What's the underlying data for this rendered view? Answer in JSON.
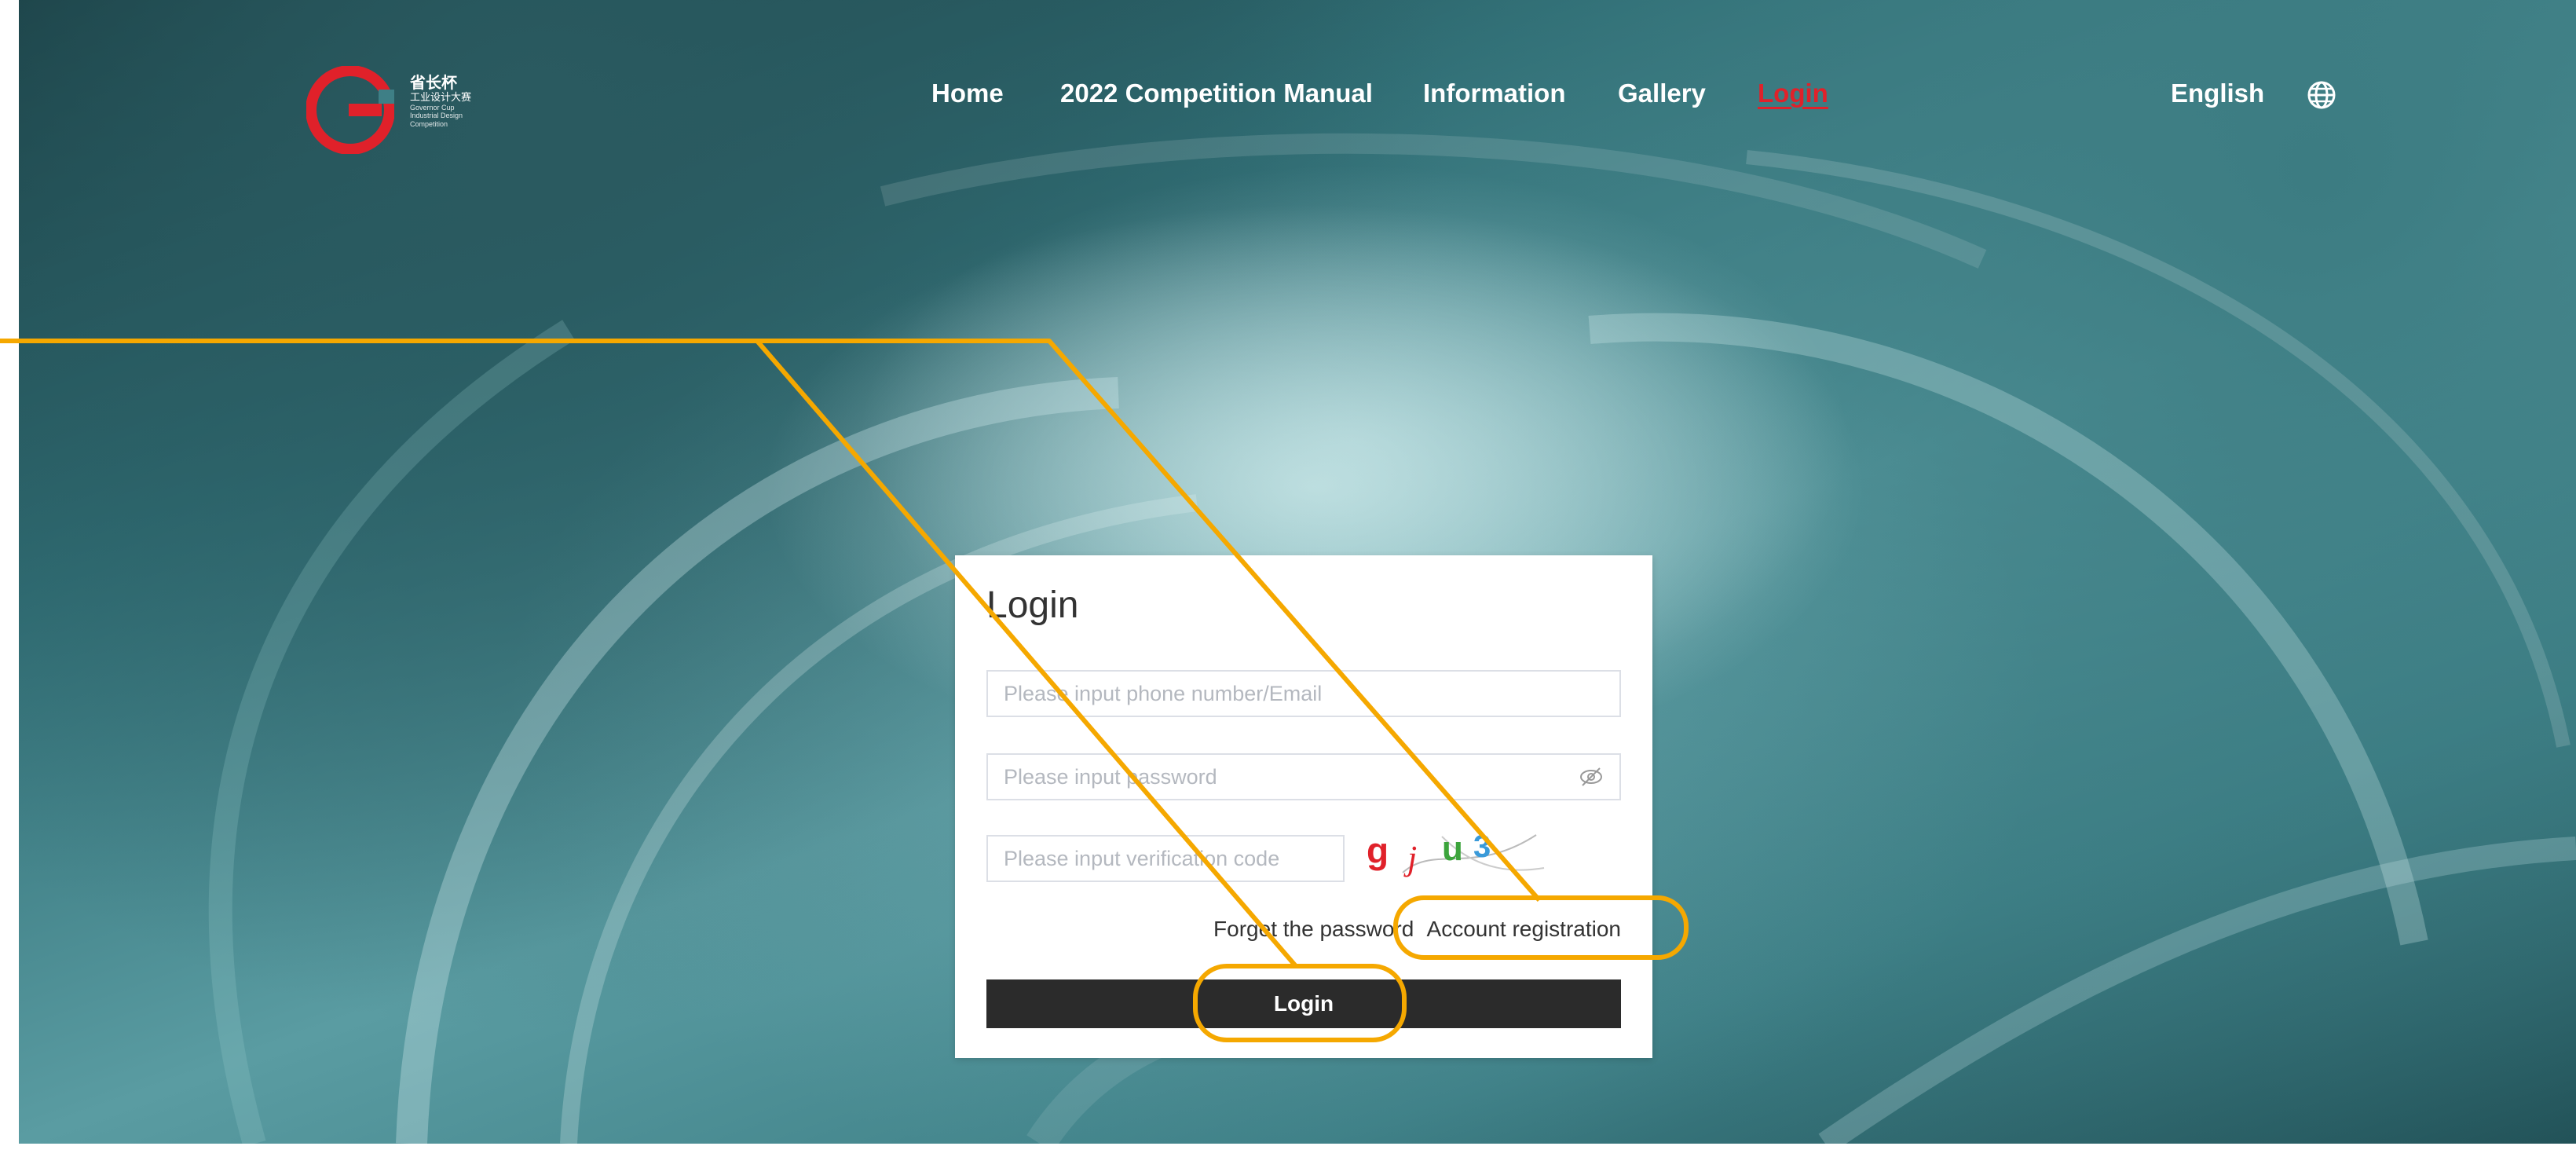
{
  "header": {
    "logo_text": {
      "cn_name": "省长杯",
      "cn_subtitle": "工业设计大赛",
      "en_line1": "Governor Cup",
      "en_line2": "Industrial Design",
      "en_line3": "Competition"
    },
    "nav": [
      {
        "label": "Home"
      },
      {
        "label": "2022 Competition Manual"
      },
      {
        "label": "Information"
      },
      {
        "label": "Gallery"
      },
      {
        "label": "Login",
        "active": true
      }
    ],
    "language_label": "English",
    "language_icon": "globe-icon"
  },
  "login_form": {
    "title": "Login",
    "account": {
      "placeholder": "Please input phone number/Email",
      "value": ""
    },
    "password": {
      "placeholder": "Please input password",
      "value": "",
      "toggle_icon": "eye-slash-icon"
    },
    "verification": {
      "placeholder": "Please input verification code",
      "value": ""
    },
    "captcha_chars": [
      "g",
      "j",
      "u",
      "3"
    ],
    "forget_password_label": "Forget the password",
    "account_registration_label": "Account registration",
    "submit_label": "Login"
  },
  "colors": {
    "accent_red": "#e0212a",
    "annotation_orange": "#f5a800",
    "button_dark": "#2b2b2b"
  }
}
